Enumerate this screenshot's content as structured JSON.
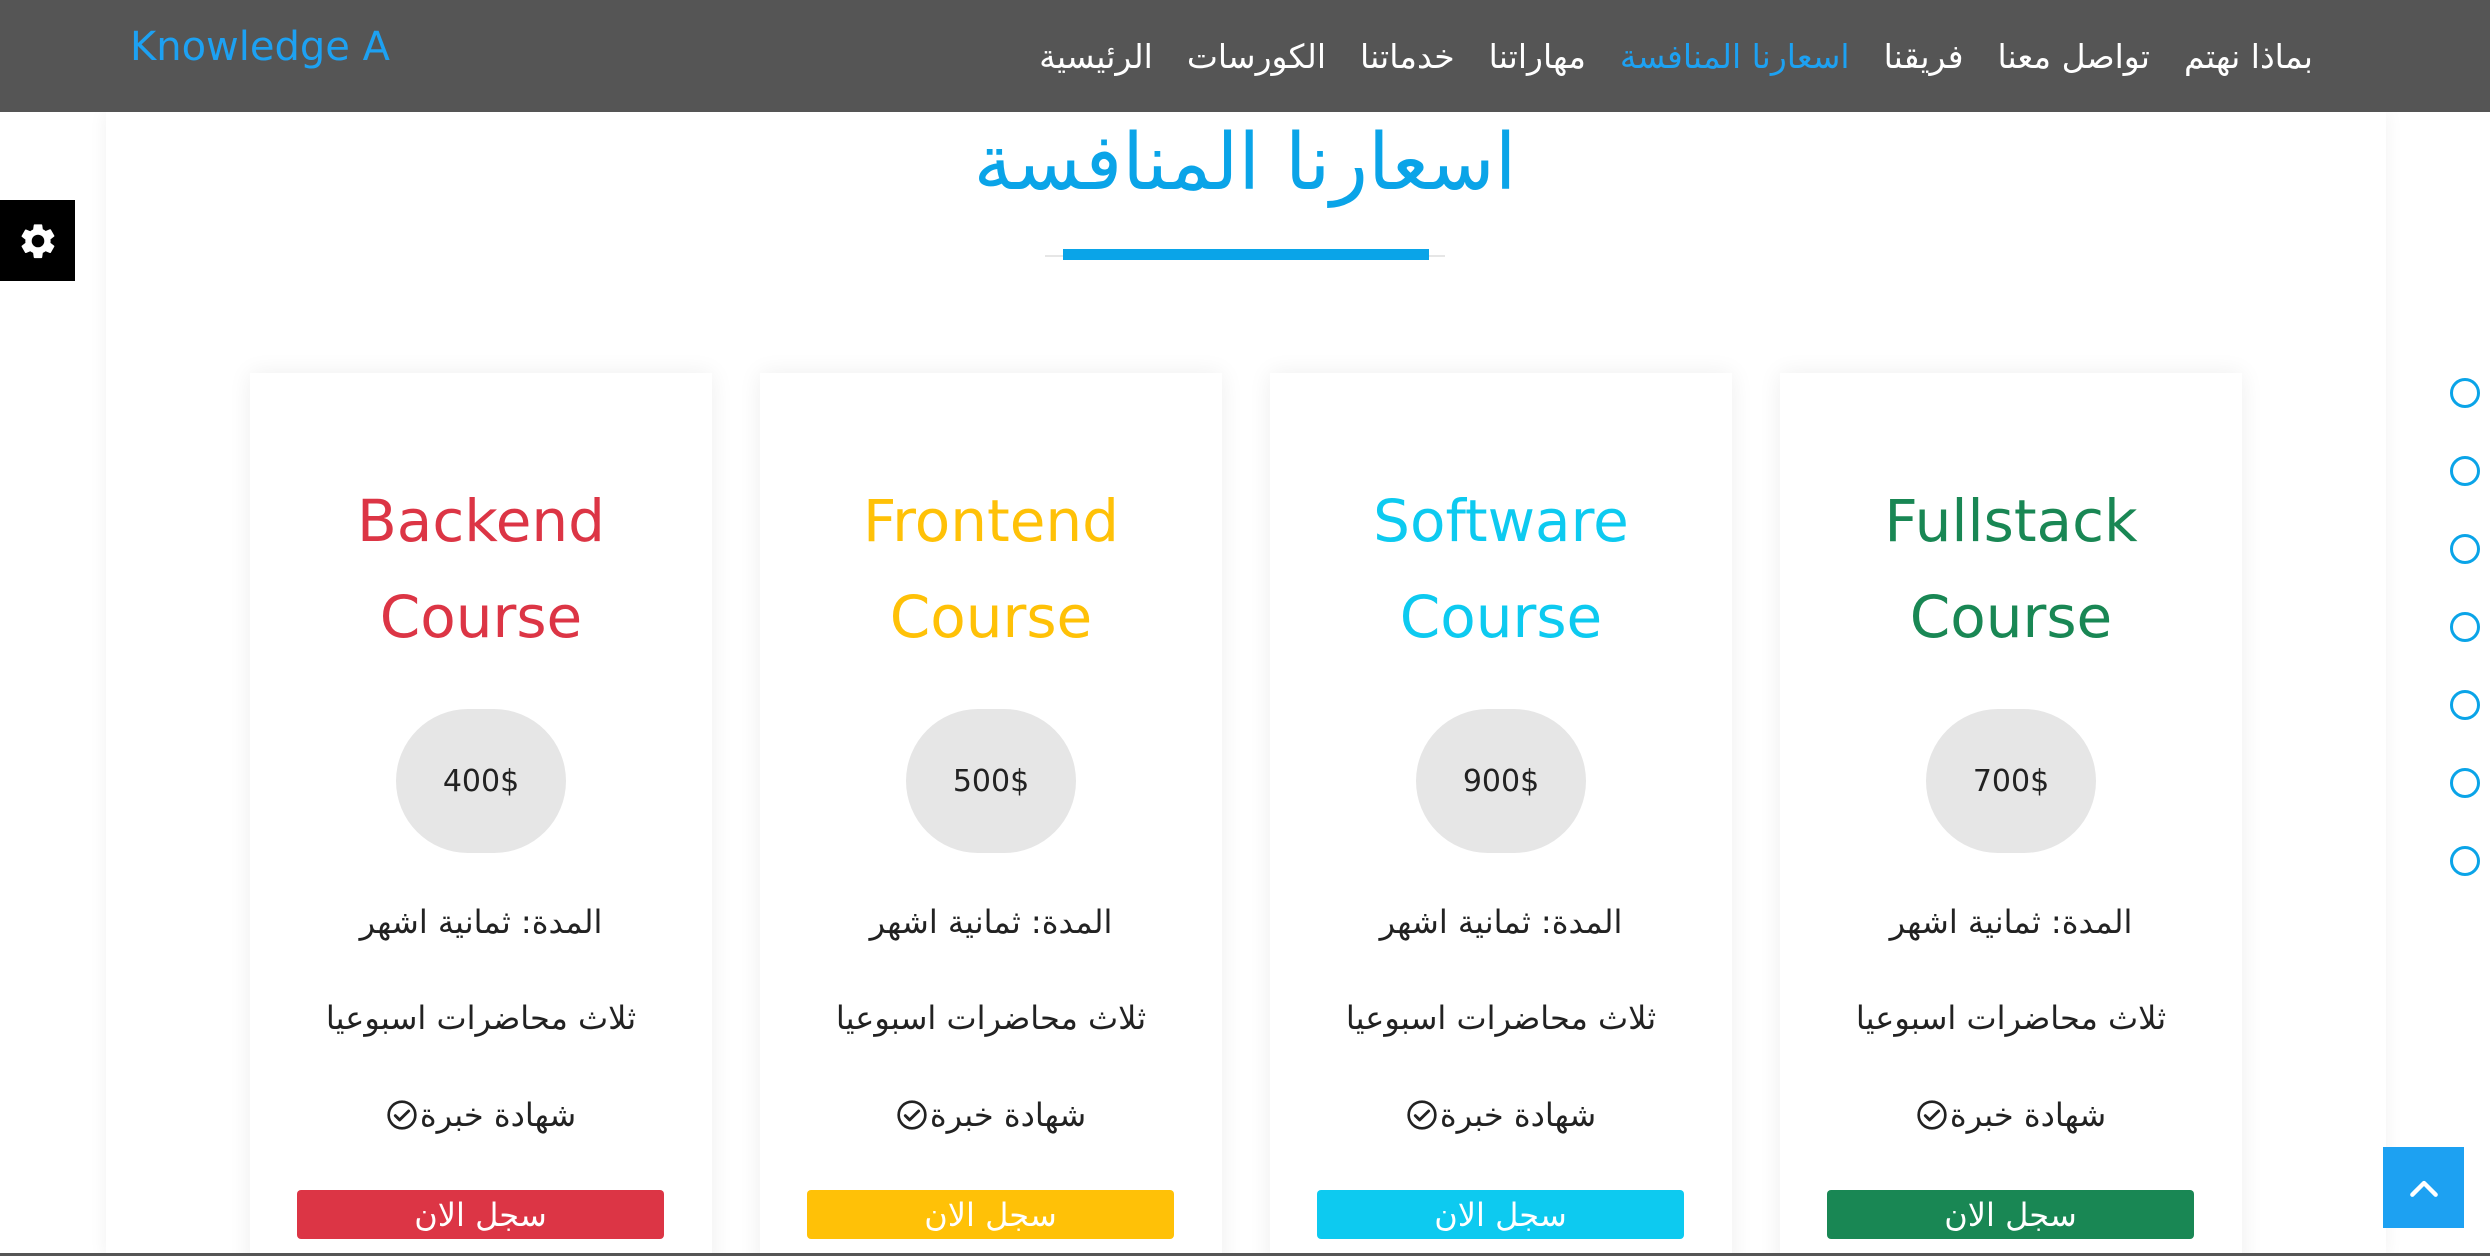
{
  "navbar": {
    "brand": "Knowledge A",
    "links": [
      {
        "label": "الرئيسية",
        "active": false
      },
      {
        "label": "الكورسات",
        "active": false
      },
      {
        "label": "خدماتنا",
        "active": false
      },
      {
        "label": "مهاراتنا",
        "active": false
      },
      {
        "label": "اسعارنا المنافسة",
        "active": true
      },
      {
        "label": "فريقنا",
        "active": false
      },
      {
        "label": "تواصل معنا",
        "active": false
      },
      {
        "label": "بماذا نهتم",
        "active": false
      }
    ]
  },
  "section": {
    "title": "اسعارنا المنافسة"
  },
  "cards": [
    {
      "title_line1": "Backend",
      "title_line2": "Course",
      "price": "400$",
      "duration": "المدة: ثمانية اشهر",
      "lectures": "ثلاث محاضرات اسبوعيا",
      "certificate": "شهادة خبرة",
      "cta": "سجل الان",
      "color": "#dc3545"
    },
    {
      "title_line1": "Frontend",
      "title_line2": "Course",
      "price": "500$",
      "duration": "المدة: ثمانية اشهر",
      "lectures": "ثلاث محاضرات اسبوعيا",
      "certificate": "شهادة خبرة",
      "cta": "سجل الان",
      "color": "#ffc107"
    },
    {
      "title_line1": "Software",
      "title_line2": "Course",
      "price": "900$",
      "duration": "المدة: ثمانية اشهر",
      "lectures": "ثلاث محاضرات اسبوعيا",
      "certificate": "شهادة خبرة",
      "cta": "سجل الان",
      "color": "#0dcaf0"
    },
    {
      "title_line1": "Fullstack",
      "title_line2": "Course",
      "price": "700$",
      "duration": "المدة: ثمانية اشهر",
      "lectures": "ثلاث محاضرات اسبوعيا",
      "certificate": "شهادة خبرة",
      "cta": "سجل الان",
      "color": "#198754"
    }
  ],
  "icons": {
    "settings": "gear-icon",
    "certificate": "check-circle-icon",
    "back_to_top": "chevron-up-icon"
  },
  "bullets": {
    "count": 7,
    "color": "#0aa4e8"
  },
  "colors": {
    "accent": "#0aa4e8",
    "navbar": "#555555"
  }
}
